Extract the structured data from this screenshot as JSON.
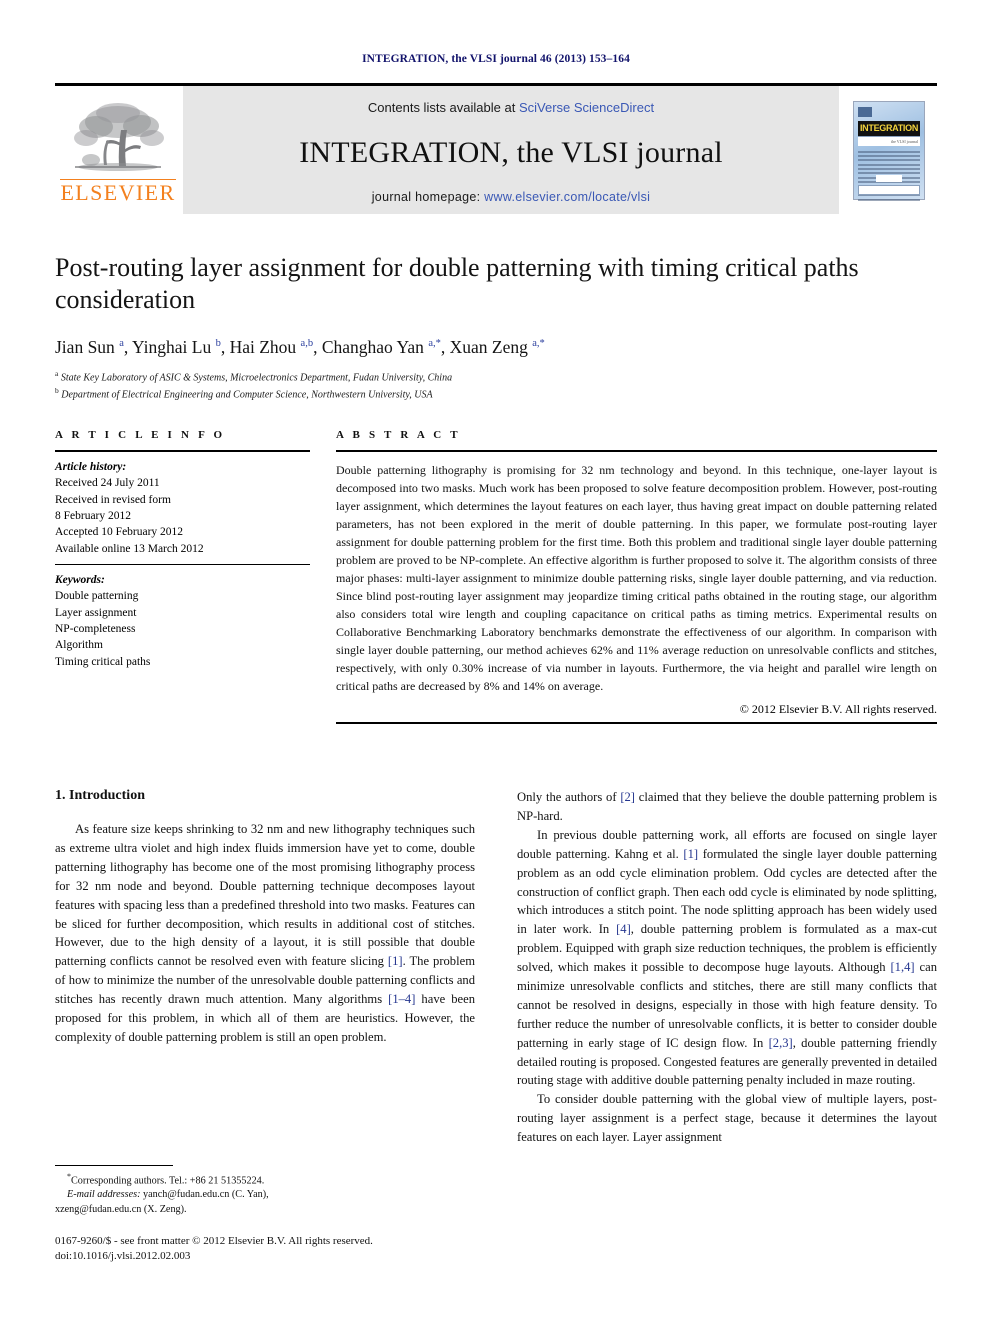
{
  "running_head": "INTEGRATION, the VLSI journal 46 (2013) 153–164",
  "masthead": {
    "publisher_name": "ELSEVIER",
    "contents_prefix": "Contents lists available at",
    "contents_link": "SciVerse ScienceDirect",
    "journal_title": "INTEGRATION, the VLSI journal",
    "homepage_prefix": "journal homepage:",
    "homepage_link": "www.elsevier.com/locate/vlsi",
    "cover_title": "INTEGRATION",
    "link_color": "#3a58b5",
    "brand_color": "#F3801E"
  },
  "article": {
    "title": "Post-routing layer assignment for double patterning with timing critical paths consideration",
    "authors_html": "Jian Sun <sup>a</sup>, Yinghai Lu <sup>b</sup>, Hai Zhou <sup>a,b</sup>, Changhao Yan <sup>a,</sup><sup>*</sup>, Xuan Zeng <sup>a,</sup><sup>*</sup>",
    "affiliations": [
      {
        "marker": "a",
        "text": "State Key Laboratory of ASIC & Systems, Microelectronics Department, Fudan University, China"
      },
      {
        "marker": "b",
        "text": "Department of Electrical Engineering and Computer Science, Northwestern University, USA"
      }
    ]
  },
  "article_info": {
    "heading": "A R T I C L E   I N F O",
    "history_label": "Article history:",
    "history": [
      "Received 24 July 2011",
      "Received in revised form",
      "8 February 2012",
      "Accepted 10 February 2012",
      "Available online 13 March 2012"
    ],
    "keywords_label": "Keywords:",
    "keywords": [
      "Double patterning",
      "Layer assignment",
      "NP-completeness",
      "Algorithm",
      "Timing critical paths"
    ]
  },
  "abstract": {
    "heading": "A B S T R A C T",
    "text": "Double patterning lithography is promising for 32 nm technology and beyond. In this technique, one-layer layout is decomposed into two masks. Much work has been proposed to solve feature decomposition problem. However, post-routing layer assignment, which determines the layout features on each layer, thus having great impact on double patterning related parameters, has not been explored in the merit of double patterning. In this paper, we formulate post-routing layer assignment for double patterning problem for the first time. Both this problem and traditional single layer double patterning problem are proved to be NP-complete. An effective algorithm is further proposed to solve it. The algorithm consists of three major phases: multi-layer assignment to minimize double patterning risks, single layer double patterning, and via reduction. Since blind post-routing layer assignment may jeopardize timing critical paths obtained in the routing stage, our algorithm also considers total wire length and coupling capacitance on critical paths as timing metrics. Experimental results on Collaborative Benchmarking Laboratory benchmarks demonstrate the effectiveness of our algorithm. In comparison with single layer double patterning, our method achieves 62% and 11% average reduction on unresolvable conflicts and stitches, respectively, with only 0.30% increase of via number in layouts. Furthermore, the via height and parallel wire length on critical paths are decreased by 8% and 14% on average.",
    "copyright": "© 2012 Elsevier B.V. All rights reserved."
  },
  "body": {
    "section_number_title": "1.  Introduction",
    "left_paragraphs": [
      "As feature size keeps shrinking to 32 nm and new lithography techniques such as extreme ultra violet and high index fluids immersion have yet to come, double patterning lithography has become one of the most promising lithography process for 32 nm node and beyond. Double patterning technique decomposes layout features with spacing less than a predefined threshold into two masks. Features can be sliced for further decomposition, which results in additional cost of stitches. However, due to the high density of a layout, it is still possible that double patterning conflicts cannot be resolved even with feature slicing [1]. The problem of how to minimize the number of the unresolvable double patterning conflicts and stitches has recently drawn much attention. Many algorithms [1–4] have been proposed for this problem, in which all of them are heuristics. However, the complexity of double patterning problem is still an open problem."
    ],
    "right_paragraphs": [
      "Only the authors of [2] claimed that they believe the double patterning problem is NP-hard.",
      "In previous double patterning work, all efforts are focused on single layer double patterning. Kahng et al. [1] formulated the single layer double patterning problem as an odd cycle elimination problem. Odd cycles are detected after the construction of conflict graph. Then each odd cycle is eliminated by node splitting, which introduces a stitch point. The node splitting approach has been widely used in later work. In [4], double patterning problem is formulated as a max-cut problem. Equipped with graph size reduction techniques, the problem is efficiently solved, which makes it possible to decompose huge layouts. Although [1,4] can minimize unresolvable conflicts and stitches, there are still many conflicts that cannot be resolved in designs, especially in those with high feature density. To further reduce the number of unresolvable conflicts, it is better to consider double patterning in early stage of IC design flow. In [2,3], double patterning friendly detailed routing is proposed. Congested features are generally prevented in detailed routing stage with additive double patterning penalty included in maze routing.",
      "To consider double patterning with the global view of multiple layers, post-routing layer assignment is a perfect stage, because it determines the layout features on each layer. Layer assignment"
    ]
  },
  "footnotes": {
    "corresponding": "Corresponding authors. Tel.: +86 21 51355224.",
    "email_label": "E-mail addresses:",
    "emails": "yanch@fudan.edu.cn (C. Yan),",
    "emails_second": "xzeng@fudan.edu.cn (X. Zeng).",
    "issn_line": "0167-9260/$ - see front matter © 2012 Elsevier B.V. All rights reserved.",
    "doi_line": "doi:10.1016/j.vlsi.2012.02.003"
  }
}
